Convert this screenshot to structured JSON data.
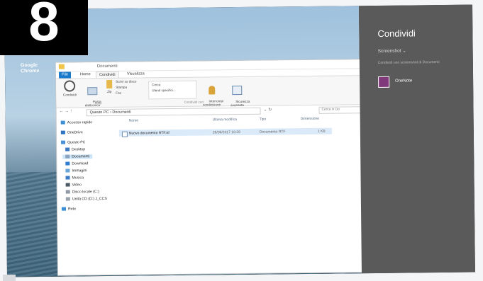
{
  "step_number": "8",
  "desktop": {
    "icon_label": "Google\nChrome"
  },
  "explorer": {
    "window_title": "Documenti",
    "tabs": [
      "File",
      "Home",
      "Condividi",
      "Visualizza"
    ],
    "ribbon": {
      "condividi": "Condividi",
      "posta": "Posta\nelettronica",
      "zip": "Zip",
      "masterizza": "Scrivi su disco",
      "stampa": "Stampa",
      "fax": "Fax",
      "invia_group": "Invia",
      "users": "Utenti specifici...",
      "cerca": "Cerca",
      "interrompi": "Interrompi\ncondivisione",
      "sicurezza": "Sicurezza\navanzata",
      "condividi_group": "Condividi con"
    },
    "address": "Questo PC  ›  Documenti",
    "search_placeholder": "Cerca in Do",
    "nav_items": [
      "Accesso rapido",
      "OneDrive",
      "Questo PC",
      "Desktop",
      "Documenti",
      "Download",
      "Immagini",
      "Musica",
      "Video",
      "Disco locale (C:)",
      "Unità CD (D:) J_CCS",
      "Rete"
    ],
    "columns": [
      "Nome",
      "Ultima modifica",
      "Tipo",
      "Dimensione"
    ],
    "file": {
      "name": "Nuovo documento RTF.rtf",
      "modified": "26/06/2017 18:29",
      "type": "Documento RTF",
      "size": "1 KB"
    }
  },
  "share_pane": {
    "title": "Condividi",
    "subtitle": "Screenshot ⌄",
    "description": "Condividi uno screenshot di Documenti",
    "app": "OneNote"
  }
}
